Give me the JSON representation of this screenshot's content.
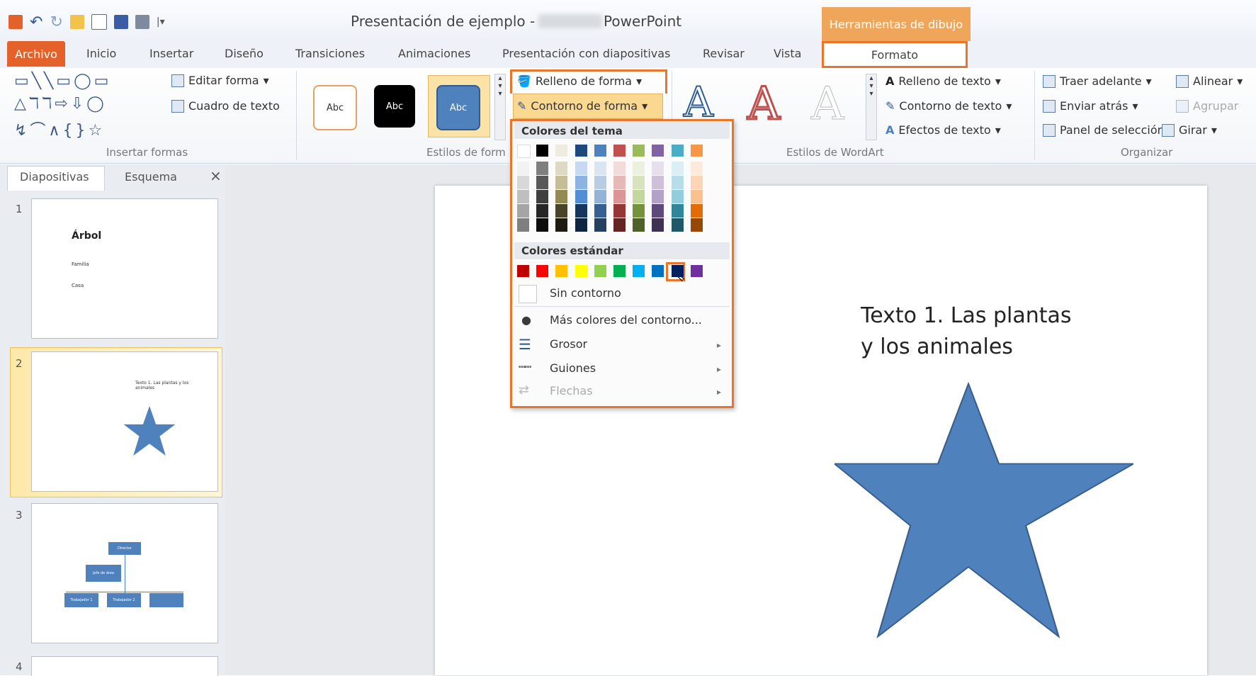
{
  "window": {
    "title": "Presentación de ejemplo  -",
    "app": "PowerPoint",
    "context_header": "Herramientas de dibujo"
  },
  "tabs": [
    "Inicio",
    "Insertar",
    "Diseño",
    "Transiciones",
    "Animaciones",
    "Presentación con diapositivas",
    "Revisar",
    "Vista"
  ],
  "tab_archivo": "Archivo",
  "tab_formato": "Formato",
  "ribbon": {
    "insert_shapes": {
      "edit_shape": "Editar forma",
      "text_box": "Cuadro de texto",
      "label": "Insertar formas"
    },
    "shape_styles": {
      "style_sample": "Abc",
      "shape_fill": "Relleno de forma",
      "shape_outline": "Contorno de forma",
      "label": "Estilos de form"
    },
    "wordart": {
      "text_fill": "Relleno de texto",
      "text_outline": "Contorno de texto",
      "text_effects": "Efectos de texto",
      "label": "Estilos de WordArt"
    },
    "arrange": {
      "bring_forward": "Traer adelante",
      "send_backward": "Enviar atrás",
      "selection_pane": "Panel de selección",
      "align": "Alinear",
      "group": "Agrupar",
      "rotate": "Girar",
      "label": "Organizar"
    }
  },
  "left_pane": {
    "tab_slides": "Diapositivas",
    "tab_outline": "Esquema",
    "close": "×",
    "slides": [
      {
        "num": "1",
        "title": "Árbol",
        "line1": "Familia",
        "line2": "Casa"
      },
      {
        "num": "2",
        "text": "Texto 1. Las plantas y los animales"
      },
      {
        "num": "3",
        "box_top": "Director",
        "box_mid": "Jefe de área",
        "box_a": "Trabajador 1",
        "box_b": "Trabajador 2"
      },
      {
        "num": "4"
      }
    ]
  },
  "slide": {
    "text_line1": "Texto 1. Las plantas",
    "text_line2": "y los animales"
  },
  "dropdown": {
    "theme_colors_header": "Colores del tema",
    "standard_colors_header": "Colores estándar",
    "no_outline": "Sin contorno",
    "more_colors": "Más colores del contorno...",
    "weight": "Grosor",
    "dashes": "Guiones",
    "arrows": "Flechas",
    "theme_top": [
      "#ffffff",
      "#000000",
      "#eeece1",
      "#1f497d",
      "#4f81bd",
      "#c0504d",
      "#9bbb59",
      "#8064a2",
      "#4bacc6",
      "#f79646"
    ],
    "theme_shades": [
      [
        "#f2f2f2",
        "#d8d8d8",
        "#bfbfbf",
        "#a5a5a5",
        "#7f7f7f"
      ],
      [
        "#7f7f7f",
        "#595959",
        "#3f3f3f",
        "#262626",
        "#0c0c0c"
      ],
      [
        "#ddd9c3",
        "#c4bd97",
        "#938953",
        "#494429",
        "#1d1b10"
      ],
      [
        "#c6d9f0",
        "#8db3e2",
        "#548dd4",
        "#17365d",
        "#0f243e"
      ],
      [
        "#dbe5f1",
        "#b8cce4",
        "#95b3d7",
        "#366092",
        "#244061"
      ],
      [
        "#f2dcdb",
        "#e5b9b7",
        "#d99694",
        "#953734",
        "#632423"
      ],
      [
        "#ebf1dd",
        "#d7e3bc",
        "#c3d69b",
        "#76923c",
        "#4f6128"
      ],
      [
        "#e5e0ec",
        "#ccc1d9",
        "#b2a2c7",
        "#5f497a",
        "#3f3151"
      ],
      [
        "#dbeef3",
        "#b7dde8",
        "#92cddc",
        "#31859b",
        "#205867"
      ],
      [
        "#fdeada",
        "#fbd5b5",
        "#fac08f",
        "#e36c09",
        "#974806"
      ]
    ],
    "standard": [
      "#c00000",
      "#ff0000",
      "#ffc000",
      "#ffff00",
      "#92d050",
      "#00b050",
      "#00b0f0",
      "#0070c0",
      "#002060",
      "#7030a0"
    ]
  }
}
